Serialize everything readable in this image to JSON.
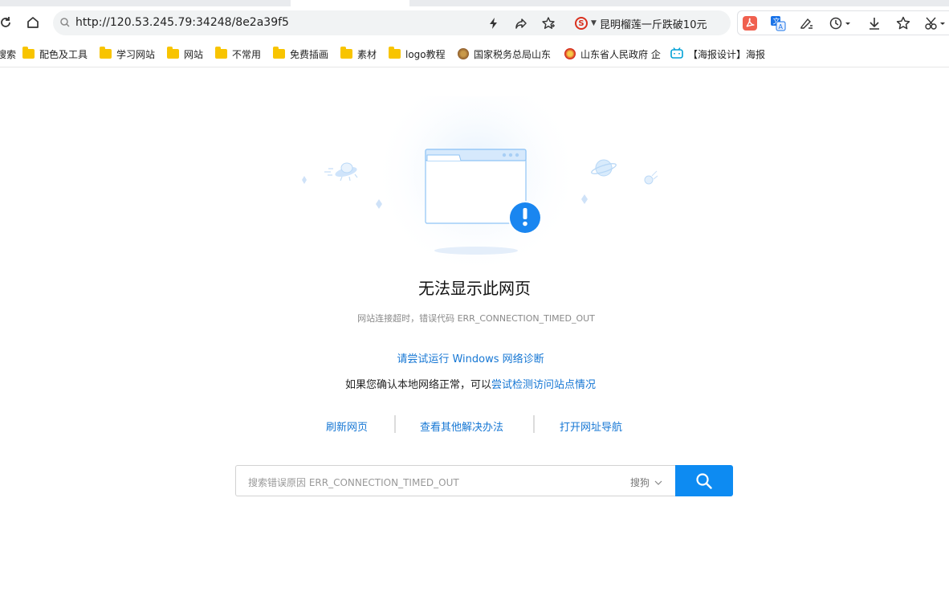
{
  "browser": {
    "url": "http://120.53.245.79:34248/8e2a39f5",
    "news_ticker": "昆明榴莲一斤跌破10元",
    "news_source_letter": "S"
  },
  "bookmarks": [
    {
      "label": "搜索",
      "icon": "partial"
    },
    {
      "label": "配色及工具",
      "icon": "folder"
    },
    {
      "label": "学习网站",
      "icon": "folder"
    },
    {
      "label": "网站",
      "icon": "folder"
    },
    {
      "label": "不常用",
      "icon": "folder"
    },
    {
      "label": "免费插画",
      "icon": "folder"
    },
    {
      "label": "素材",
      "icon": "folder"
    },
    {
      "label": "logo教程",
      "icon": "folder"
    },
    {
      "label": "国家税务总局山东",
      "icon": "tax-emblem"
    },
    {
      "label": "山东省人民政府 企",
      "icon": "gov-emblem"
    },
    {
      "label": "【海报设计】海报",
      "icon": "bilibili"
    }
  ],
  "error": {
    "title": "无法显示此网页",
    "subtitle": "网站连接超时，错误代码 ERR_CONNECTION_TIMED_OUT",
    "diagnose_link": "请尝试运行 Windows 网络诊断",
    "confirm_prefix": "如果您确认本地网络正常，可以",
    "confirm_link": "尝试检测访问站点情况",
    "actions": {
      "refresh": "刷新网页",
      "other_solutions": "查看其他解决办法",
      "open_nav": "打开网址导航"
    },
    "search": {
      "placeholder": "搜索错误原因 ERR_CONNECTION_TIMED_OUT",
      "engine": "搜狗"
    }
  },
  "colors": {
    "accent": "#0d8bf2",
    "link": "#1677d4",
    "folder": "#f8c400",
    "alert": "#1a86f0"
  }
}
